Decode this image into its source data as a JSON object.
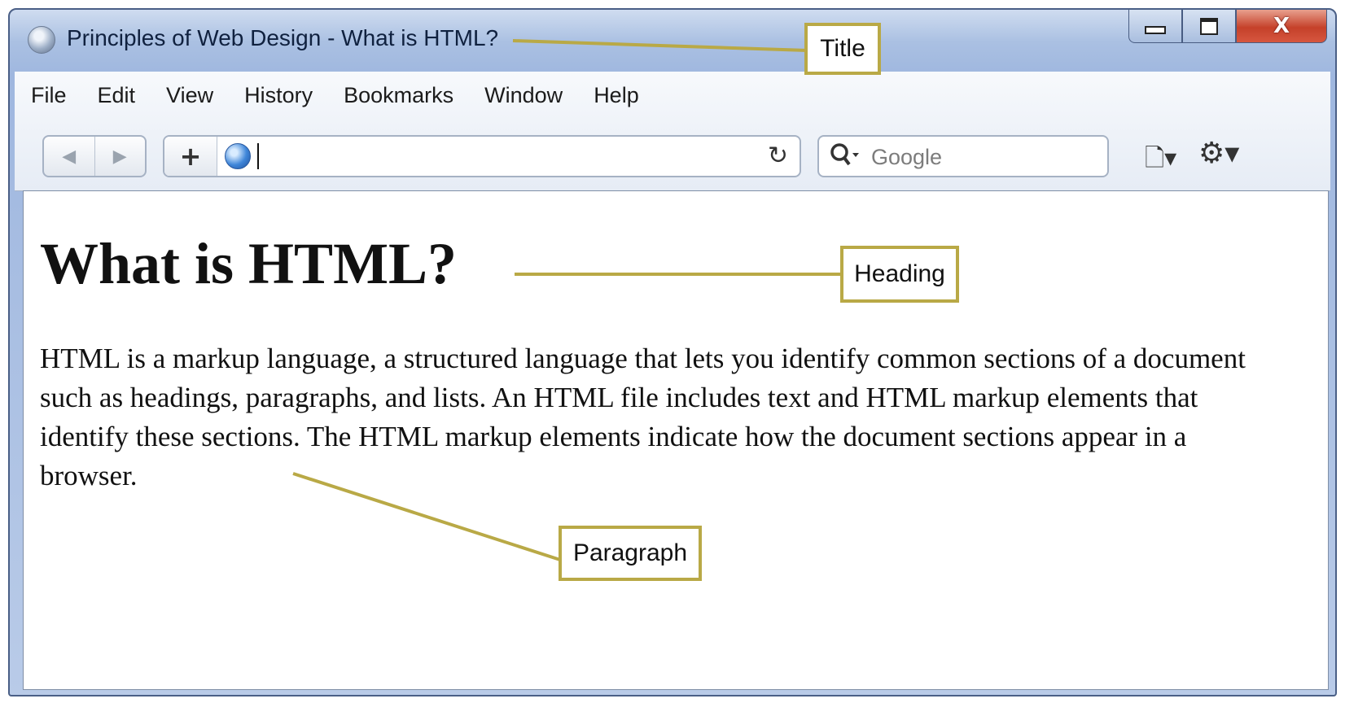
{
  "window": {
    "title": "Principles of Web Design - What is HTML?",
    "close_label": "X"
  },
  "menubar": {
    "items": [
      "File",
      "Edit",
      "View",
      "History",
      "Bookmarks",
      "Window",
      "Help"
    ]
  },
  "navbar": {
    "back_glyph": "◀",
    "forward_glyph": "▶",
    "new_tab_glyph": "+",
    "url_value": "",
    "reload_glyph": "↻",
    "search_placeholder": "Google",
    "page_menu_glyph": "🗋▾",
    "tools_menu_glyph": "⚙▾"
  },
  "page": {
    "heading": "What is HTML?",
    "paragraph": "HTML is a markup language, a structured language that lets you identify common sections of a document such as headings, paragraphs, and lists. An HTML file includes text and HTML markup elements that identify these sections. The HTML markup elements indicate how the document sections appear in a browser."
  },
  "callouts": {
    "title": "Title",
    "heading": "Heading",
    "paragraph": "Paragraph"
  },
  "colors": {
    "callout_border": "#b9a946",
    "frame_blue": "#9fb7df"
  },
  "icons": [
    "browser-app-icon",
    "minimize-icon",
    "maximize-icon",
    "close-icon",
    "back-arrow-icon",
    "forward-arrow-icon",
    "new-tab-plus-icon",
    "globe-icon",
    "reload-icon",
    "search-icon",
    "page-menu-icon",
    "gear-icon"
  ]
}
